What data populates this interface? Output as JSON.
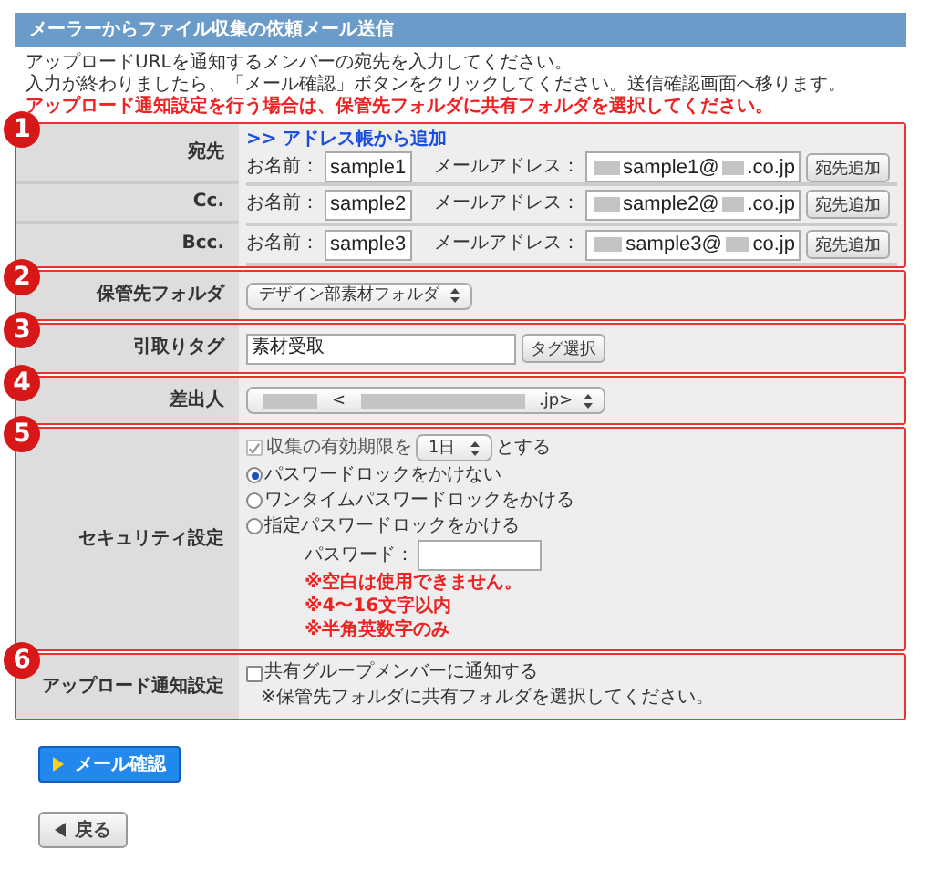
{
  "header": {
    "title": "メーラーからファイル収集の依頼メール送信"
  },
  "intro": [
    "アップロードURLを通知するメンバーの宛先を入力してください。",
    "入力が終わりましたら、「メール確認」ボタンをクリックしてください。送信確認画面へ移ります。"
  ],
  "warning": "アップロード通知設定を行う場合は、保管先フォルダに共有フォルダを選択してください。",
  "sections": [
    {
      "badge": "1",
      "kind": "recipients",
      "link": ">> アドレス帳から追加",
      "rows": [
        {
          "label": "宛先",
          "name_label": "お名前：",
          "name": "sample1",
          "email_label": "メールアドレス：",
          "email_parts": [
            "sample1@",
            ".co.jp"
          ],
          "button": "宛先追加"
        },
        {
          "label": "Cc.",
          "name_label": "お名前：",
          "name": "sample2",
          "email_label": "メールアドレス：",
          "email_parts": [
            "sample2@",
            ".co.jp"
          ],
          "button": "宛先追加"
        },
        {
          "label": "Bcc.",
          "name_label": "お名前：",
          "name": "sample3",
          "email_label": "メールアドレス：",
          "email_parts": [
            "sample3@",
            "co.jp"
          ],
          "button": "宛先追加"
        }
      ]
    },
    {
      "badge": "2",
      "kind": "select",
      "label": "保管先フォルダ",
      "value": "デザイン部素材フォルダ"
    },
    {
      "badge": "3",
      "kind": "tag",
      "label": "引取りタグ",
      "value": "素材受取",
      "button": "タグ選択"
    },
    {
      "badge": "4",
      "kind": "sender",
      "label": "差出人",
      "value_parts": [
        "<",
        ".jp>"
      ]
    },
    {
      "badge": "5",
      "kind": "security",
      "label": "セキュリティ設定",
      "expiry": {
        "checked": true,
        "disabled": true,
        "before": "収集の有効期限を",
        "value": "1日",
        "after": "とする"
      },
      "options": [
        {
          "label": "パスワードロックをかけない",
          "selected": true
        },
        {
          "label": "ワンタイムパスワードロックをかける",
          "selected": false
        },
        {
          "label": "指定パスワードロックをかける",
          "selected": false
        }
      ],
      "password_label": "パスワード：",
      "notes": [
        "※空白は使用できません。",
        "※4〜16文字以内",
        "※半角英数字のみ"
      ]
    },
    {
      "badge": "6",
      "kind": "notify",
      "label": "アップロード通知設定",
      "checkbox": {
        "label": "共有グループメンバーに通知する",
        "checked": false
      },
      "note": "※保管先フォルダに共有フォルダを選択してください。"
    }
  ],
  "confirm_button": "メール確認",
  "back_button": "戻る"
}
